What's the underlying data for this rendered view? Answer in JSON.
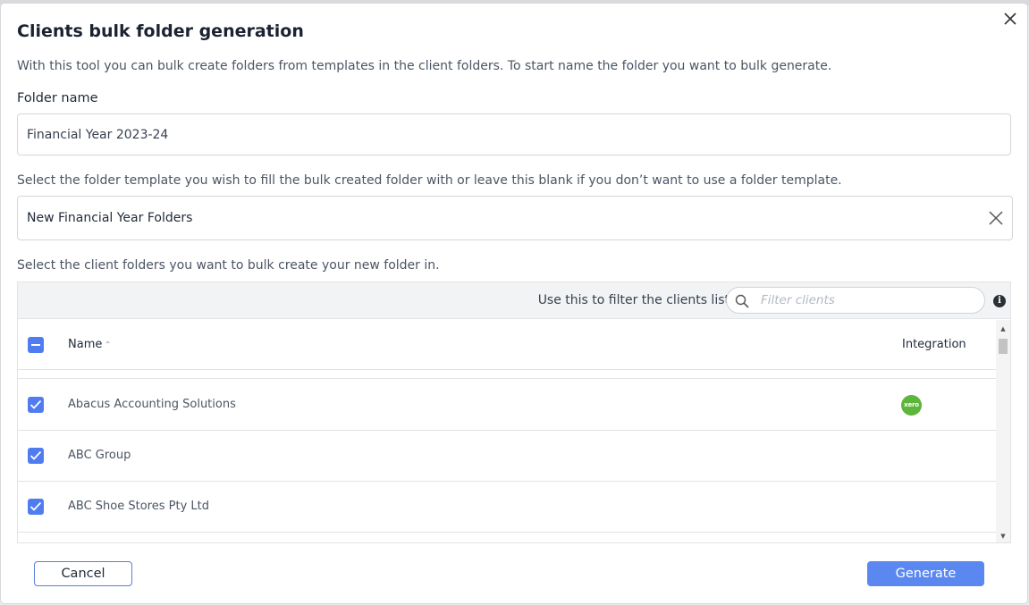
{
  "dialog": {
    "title": "Clients bulk folder generation",
    "intro": "With this tool you can bulk create folders from templates in the client folders. To start name the folder you want to bulk generate.",
    "close_icon": "close-icon"
  },
  "folder": {
    "label": "Folder name",
    "value": "Financial Year 2023-24"
  },
  "template": {
    "description": "Select the folder template you wish to fill the bulk created folder with or leave this blank if you don’t want to use a folder template.",
    "value": "New Financial Year Folders",
    "clear_icon": "clear-icon"
  },
  "clients": {
    "description": "Select the client folders you want to bulk create your new folder in.",
    "filter_label": "Use this to filter the clients list",
    "filter_placeholder": "Filter clients",
    "columns": {
      "name": "Name",
      "integration": "Integration"
    },
    "rows": [
      {
        "name": "Abacus Accounting Solutions",
        "checked": true,
        "integration": "xero"
      },
      {
        "name": "ABC Group",
        "checked": true,
        "integration": ""
      },
      {
        "name": "ABC Shoe Stores Pty Ltd",
        "checked": true,
        "integration": ""
      }
    ],
    "select_all_state": "indeterminate"
  },
  "buttons": {
    "cancel": "Cancel",
    "generate": "Generate"
  },
  "colors": {
    "accent": "#4f7cf1",
    "primary_button": "#5b87f0",
    "xero_green": "#5eb53b"
  }
}
